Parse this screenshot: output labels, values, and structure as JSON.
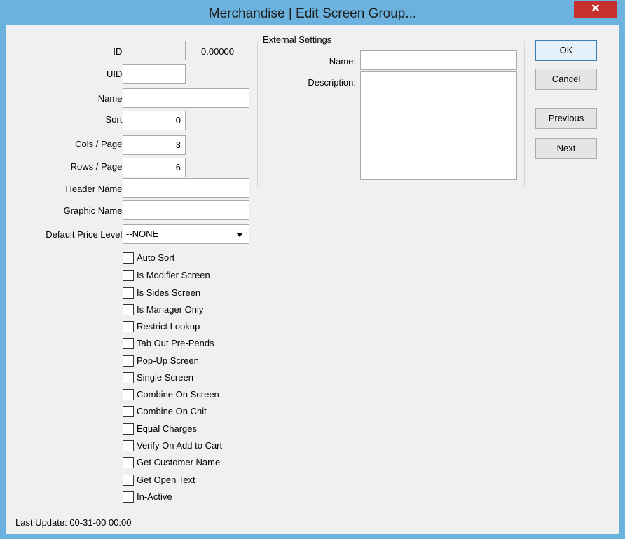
{
  "window": {
    "title": "Merchandise | Edit Screen Group...",
    "close_glyph": "✕"
  },
  "form": {
    "id": {
      "label": "ID:",
      "value": "",
      "extra": "0.00000"
    },
    "uid": {
      "label": "UID:",
      "value": ""
    },
    "name": {
      "label": "Name:",
      "value": ""
    },
    "sort": {
      "label": "Sort:",
      "value": "0"
    },
    "cols": {
      "label": "Cols / Page:",
      "value": "3"
    },
    "rows": {
      "label": "Rows / Page:",
      "value": "6"
    },
    "header_name": {
      "label": "Header Name:",
      "value": ""
    },
    "graphic_name": {
      "label": "Graphic Name:",
      "value": ""
    },
    "price_level": {
      "label": "Default Price Level:",
      "value": "--NONE"
    }
  },
  "checkboxes": [
    {
      "label": "Auto Sort",
      "checked": false
    },
    {
      "label": "Is Modifier Screen",
      "checked": false
    },
    {
      "label": "Is Sides Screen",
      "checked": false
    },
    {
      "label": "Is Manager Only",
      "checked": false
    },
    {
      "label": "Restrict Lookup",
      "checked": false
    },
    {
      "label": "Tab Out Pre-Pends",
      "checked": false
    },
    {
      "label": "Pop-Up Screen",
      "checked": false
    },
    {
      "label": "Single Screen",
      "checked": false
    },
    {
      "label": "Combine On Screen",
      "checked": false
    },
    {
      "label": "Combine On Chit",
      "checked": false
    },
    {
      "label": "Equal Charges",
      "checked": false
    },
    {
      "label": "Verify On Add to Cart",
      "checked": false
    },
    {
      "label": "Get Customer Name",
      "checked": false
    },
    {
      "label": "Get Open Text",
      "checked": false
    },
    {
      "label": "In-Active",
      "checked": false
    }
  ],
  "external": {
    "title": "External Settings",
    "name_label": "Name:",
    "name_value": "",
    "description_label": "Description:",
    "description_value": ""
  },
  "buttons": {
    "ok": "OK",
    "cancel": "Cancel",
    "previous": "Previous",
    "next": "Next"
  },
  "status": {
    "last_update": "Last Update: 00-31-00 00:00"
  }
}
